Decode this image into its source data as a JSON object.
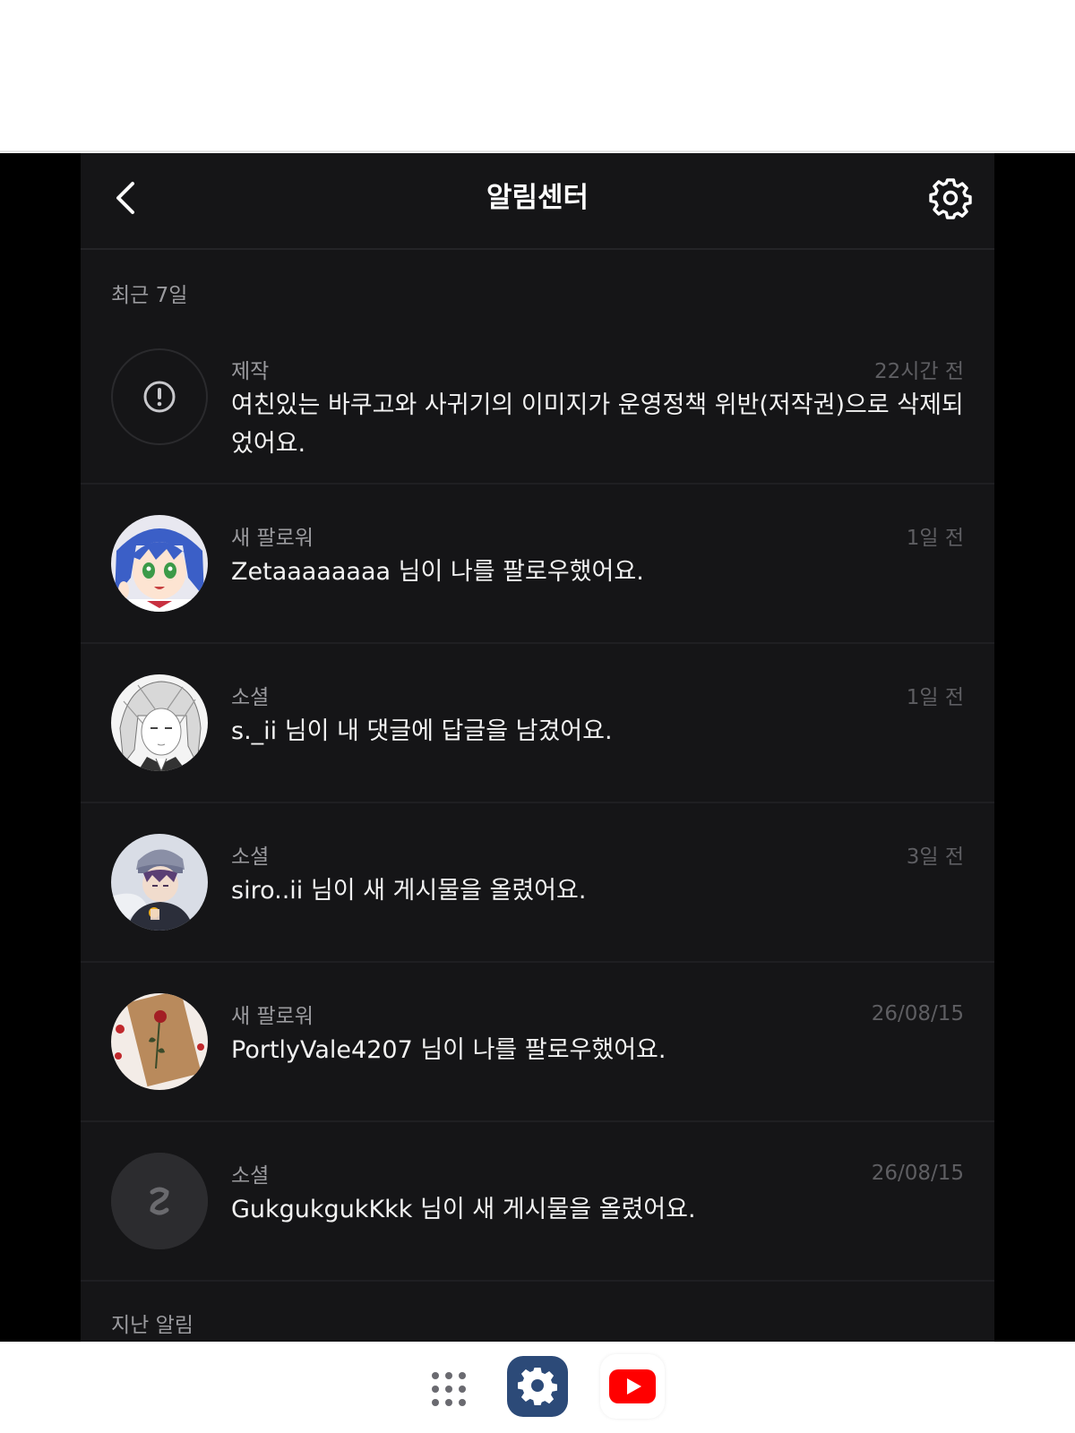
{
  "header": {
    "title": "알림센터",
    "back_icon": "chevron-left-icon",
    "settings_icon": "gear-icon"
  },
  "sections": {
    "recent_label": "최근 7일",
    "past_label": "지난 알림"
  },
  "notifications": [
    {
      "category": "제작",
      "time": "22시간 전",
      "message": "여친있는 바쿠고와 사귀기의 이미지가 운영정책 위반(저작권)으로 삭제되었어요.",
      "avatar": "alert-icon"
    },
    {
      "category": "새 팔로워",
      "time": "1일 전",
      "message": "Zetaaaaaaaa 님이 나를 팔로우했어요.",
      "avatar": "anime-girl-blue-hair"
    },
    {
      "category": "소셜",
      "time": "1일 전",
      "message": "s._ii 님이 내 댓글에 답글을 남겼어요.",
      "avatar": "sketch-portrait"
    },
    {
      "category": "소셜",
      "time": "3일 전",
      "message": "siro..ii 님이 새 게시물을 올렸어요.",
      "avatar": "anime-boy-hat"
    },
    {
      "category": "새 팔로워",
      "time": "26/08/15",
      "message": "PortlyVale4207 님이 나를 팔로우했어요.",
      "avatar": "rose-paper"
    },
    {
      "category": "소셜",
      "time": "26/08/15",
      "message": "GukgukgukKkk 님이 새 게시물을 올렸어요.",
      "avatar": "default-logo-avatar"
    }
  ],
  "dock": {
    "apps": "grid-icon",
    "settings": "settings-app-icon",
    "youtube": "youtube-app-icon"
  },
  "colors": {
    "panel_bg": "#151517",
    "outer_bg": "#000000",
    "message_text": "#f2f2f2",
    "muted_text": "#9a9a9e",
    "time_text": "#5e5e62",
    "youtube_red": "#ff0000"
  }
}
